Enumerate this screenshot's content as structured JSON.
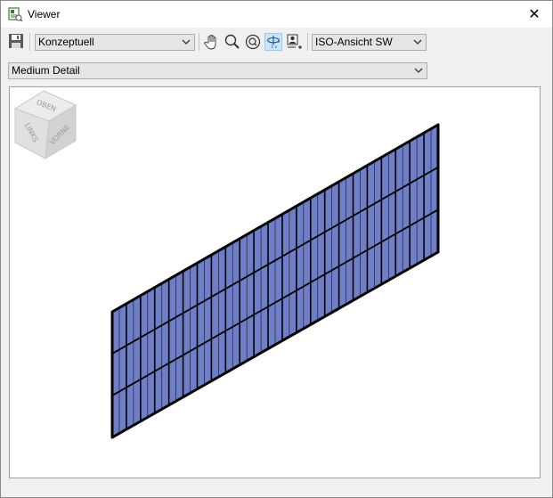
{
  "window": {
    "title": "Viewer",
    "close_glyph": "✕"
  },
  "toolbar": {
    "save_icon": "save-icon",
    "visual_style": "Konzeptuell",
    "tools": [
      "pan-icon",
      "zoom-icon",
      "zoom-extents-icon",
      "orbit-icon",
      "camera-icon"
    ],
    "active_tool": "orbit-icon",
    "view": "ISO-Ansicht SW"
  },
  "detail_level": "Medium Detail",
  "viewcube": {
    "top": "OBEN",
    "left": "LINKS",
    "front": "VORNE"
  },
  "model": {
    "type": "solar panel array",
    "cell_columns": 46,
    "cell_rows": 3,
    "cell_color": "#6e7ec8",
    "frame_color": "#000000"
  },
  "colors": {
    "viewport_bg": "#ffffff",
    "chrome_bg": "#f0f0f0",
    "active_tool_bg": "#cce4f7"
  }
}
